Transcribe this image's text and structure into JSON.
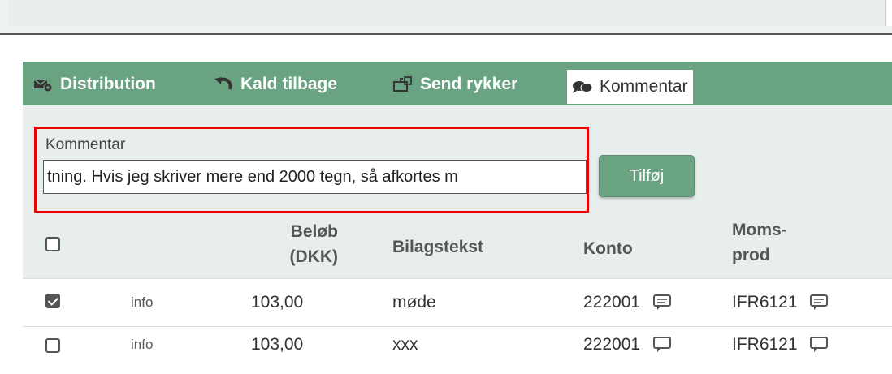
{
  "toolbar": {
    "items": [
      {
        "label": "Distribution",
        "icon": "envelope-gear-icon"
      },
      {
        "label": "Kald tilbage",
        "icon": "undo-icon"
      },
      {
        "label": "Send rykker",
        "icon": "mailbox-icon"
      },
      {
        "label": "Kommentar",
        "icon": "comments-icon",
        "active": true
      }
    ]
  },
  "comment_form": {
    "label": "Kommentar",
    "value": "tning. Hvis jeg skriver mere end 2000 tegn, så afkortes m",
    "button": "Tilføj"
  },
  "table": {
    "headers": {
      "amount_line1": "Beløb",
      "amount_line2": "(DKK)",
      "text": "Bilagstekst",
      "account": "Konto",
      "vat_line1": "Moms-",
      "vat_line2": "prod"
    },
    "rows": [
      {
        "checked": true,
        "info": "info",
        "amount": "103,00",
        "text": "møde",
        "account": "222001",
        "vat": "IFR6121"
      },
      {
        "checked": false,
        "info": "info",
        "amount": "103,00",
        "text": "xxx",
        "account": "222001",
        "vat": "IFR6121"
      }
    ]
  },
  "colors": {
    "toolbar_green": "#6aa381",
    "panel_bg": "#e8eeeb",
    "highlight_red": "#e00000"
  }
}
